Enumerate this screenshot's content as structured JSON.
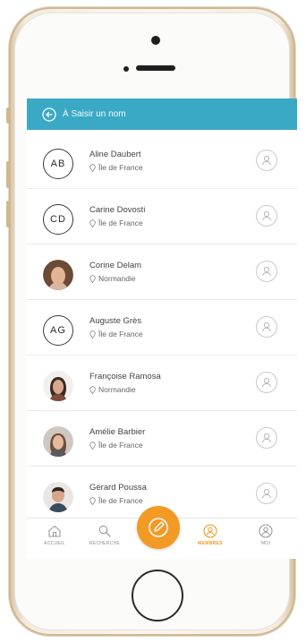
{
  "search": {
    "placeholder": "À  Saisir un nom"
  },
  "contacts": [
    {
      "initials": "AB",
      "name": "Aline Daubert",
      "region": "Île de France",
      "avatar_type": "initials"
    },
    {
      "initials": "CD",
      "name": "Carine Dovosti",
      "region": "Île de France",
      "avatar_type": "initials"
    },
    {
      "initials": "",
      "name": "Corine Delam",
      "region": "Normandie",
      "avatar_type": "photo"
    },
    {
      "initials": "AG",
      "name": "Auguste Grès",
      "region": "Île de France",
      "avatar_type": "initials"
    },
    {
      "initials": "",
      "name": "Françoise Ramosa",
      "region": "Normandie",
      "avatar_type": "photo"
    },
    {
      "initials": "",
      "name": "Amélie Barbier",
      "region": "Île de France",
      "avatar_type": "photo"
    },
    {
      "initials": "",
      "name": "Gérard Poussa",
      "region": "Île de France",
      "avatar_type": "photo"
    }
  ],
  "nav": {
    "items": [
      {
        "label": "ACCUEIL",
        "icon": "home-icon",
        "active": false
      },
      {
        "label": "RECHERCHE",
        "icon": "search-icon",
        "active": false
      },
      {
        "label": "MEMBRES",
        "icon": "members-icon",
        "active": true
      },
      {
        "label": "MOI",
        "icon": "me-icon",
        "active": false
      }
    ]
  },
  "colors": {
    "accent_blue": "#3aa9c6",
    "accent_orange": "#f39a24",
    "text_dark": "#444444",
    "text_muted": "#8c8c8c"
  }
}
